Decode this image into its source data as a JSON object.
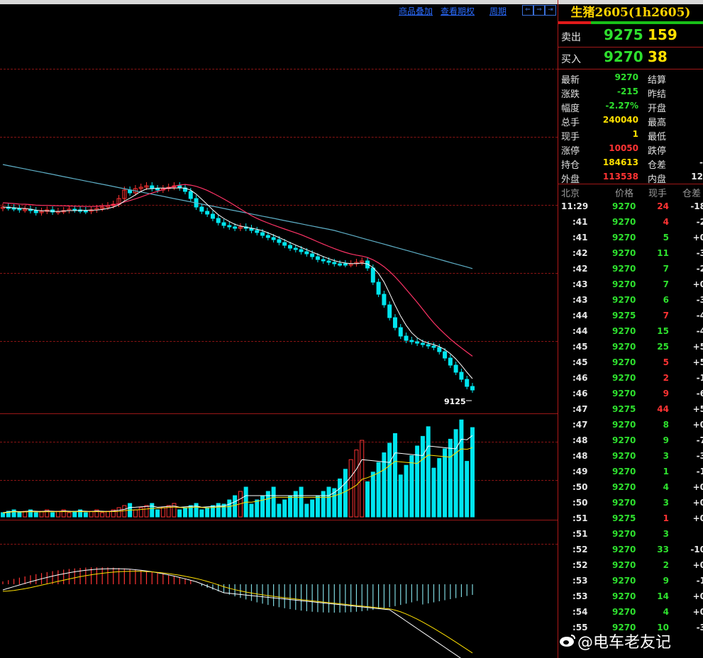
{
  "toolbar": {
    "overlay": "商品叠加",
    "options": "查看期权",
    "period": "周期"
  },
  "chart": {
    "last_label": "9125"
  },
  "quote": {
    "title": "生猪2605(1h2605)",
    "ask_label": "卖出",
    "ask_price": "9275",
    "ask_vol": "159",
    "bid_label": "买入",
    "bid_price": "9270",
    "bid_vol": "38"
  },
  "stats": [
    {
      "l1": "最新",
      "v1": "9270",
      "c1": "g",
      "l2": "结算",
      "v2": ""
    },
    {
      "l1": "涨跌",
      "v1": "-215",
      "c1": "g",
      "l2": "昨结",
      "v2": ""
    },
    {
      "l1": "幅度",
      "v1": "-2.27%",
      "c1": "g",
      "l2": "开盘",
      "v2": ""
    },
    {
      "l1": "总手",
      "v1": "240040",
      "c1": "y",
      "l2": "最高",
      "v2": ""
    },
    {
      "l1": "现手",
      "v1": "1",
      "c1": "y",
      "l2": "最低",
      "v2": ""
    },
    {
      "l1": "涨停",
      "v1": "10050",
      "c1": "r",
      "l2": "跌停",
      "v2": ""
    },
    {
      "l1": "持仓",
      "v1": "184613",
      "c1": "y",
      "l2": "仓差",
      "v2": "-"
    },
    {
      "l1": "外盘",
      "v1": "113538",
      "c1": "r",
      "l2": "内盘",
      "v2": "12"
    }
  ],
  "ticks_header": {
    "time": "北京",
    "price": "价格",
    "vol": "现手",
    "oi": "仓差"
  },
  "ticks": [
    {
      "t": "11:29",
      "p": "9270",
      "v": "24",
      "vc": "r",
      "d": "-18"
    },
    {
      "t": ":41",
      "p": "9270",
      "v": "4",
      "vc": "r",
      "d": "-2"
    },
    {
      "t": ":41",
      "p": "9270",
      "v": "5",
      "vc": "g",
      "d": "+0"
    },
    {
      "t": ":42",
      "p": "9270",
      "v": "11",
      "vc": "g",
      "d": "-3"
    },
    {
      "t": ":42",
      "p": "9270",
      "v": "7",
      "vc": "g",
      "d": "-2"
    },
    {
      "t": ":43",
      "p": "9270",
      "v": "7",
      "vc": "g",
      "d": "+0"
    },
    {
      "t": ":43",
      "p": "9270",
      "v": "6",
      "vc": "g",
      "d": "-3"
    },
    {
      "t": ":44",
      "p": "9275",
      "v": "7",
      "vc": "r",
      "d": "-4"
    },
    {
      "t": ":44",
      "p": "9270",
      "v": "15",
      "vc": "g",
      "d": "-4"
    },
    {
      "t": ":45",
      "p": "9270",
      "v": "25",
      "vc": "g",
      "d": "+5"
    },
    {
      "t": ":45",
      "p": "9270",
      "v": "5",
      "vc": "r",
      "d": "+5"
    },
    {
      "t": ":46",
      "p": "9270",
      "v": "2",
      "vc": "r",
      "d": "-1"
    },
    {
      "t": ":46",
      "p": "9270",
      "v": "9",
      "vc": "r",
      "d": "-6"
    },
    {
      "t": ":47",
      "p": "9275",
      "v": "44",
      "vc": "r",
      "d": "+5"
    },
    {
      "t": ":47",
      "p": "9270",
      "v": "8",
      "vc": "g",
      "d": "+0"
    },
    {
      "t": ":48",
      "p": "9270",
      "v": "9",
      "vc": "g",
      "d": "-7"
    },
    {
      "t": ":48",
      "p": "9270",
      "v": "3",
      "vc": "g",
      "d": "-3"
    },
    {
      "t": ":49",
      "p": "9270",
      "v": "1",
      "vc": "g",
      "d": "-1"
    },
    {
      "t": ":50",
      "p": "9270",
      "v": "4",
      "vc": "g",
      "d": "+0"
    },
    {
      "t": ":50",
      "p": "9270",
      "v": "3",
      "vc": "g",
      "d": "+0"
    },
    {
      "t": ":51",
      "p": "9275",
      "v": "1",
      "vc": "r",
      "d": "+0"
    },
    {
      "t": ":51",
      "p": "9270",
      "v": "3",
      "vc": "g",
      "d": ""
    },
    {
      "t": ":52",
      "p": "9270",
      "v": "33",
      "vc": "g",
      "d": "-10"
    },
    {
      "t": ":52",
      "p": "9270",
      "v": "2",
      "vc": "g",
      "d": "+0"
    },
    {
      "t": ":53",
      "p": "9270",
      "v": "9",
      "vc": "g",
      "d": "-1"
    },
    {
      "t": ":53",
      "p": "9270",
      "v": "14",
      "vc": "g",
      "d": "+0"
    },
    {
      "t": ":54",
      "p": "9270",
      "v": "4",
      "vc": "g",
      "d": "+0"
    },
    {
      "t": ":55",
      "p": "9270",
      "v": "10",
      "vc": "g",
      "d": "-3"
    }
  ],
  "watermark": "@电车老友记",
  "colors": {
    "up": "#ff3333",
    "down": "#00e5ee",
    "ma5": "#ffffff",
    "ma10": "#ff3366",
    "ma20": "#5fb0c8",
    "dea": "#ffe000"
  }
}
